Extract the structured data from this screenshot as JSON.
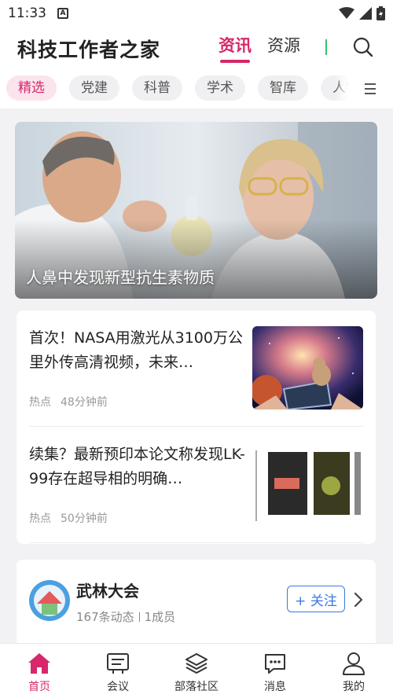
{
  "status_bar": {
    "time": "11:33",
    "a_glyph": "A"
  },
  "header": {
    "brand": "科技工作者之家",
    "tabs": [
      {
        "label": "资讯",
        "active": true
      },
      {
        "label": "资源",
        "active": false
      }
    ],
    "search_icon": "search-icon"
  },
  "categories": {
    "items": [
      {
        "label": "精选",
        "active": true
      },
      {
        "label": "党建",
        "active": false
      },
      {
        "label": "科普",
        "active": false
      },
      {
        "label": "学术",
        "active": false
      },
      {
        "label": "智库",
        "active": false
      },
      {
        "label": "人物",
        "active": false
      }
    ],
    "more_icon": "menu-icon"
  },
  "hero": {
    "title": "人鼻中发现新型抗生素物质"
  },
  "news": [
    {
      "title": "首次！NASA用激光从3100万公里外传高清视频，未来…",
      "tag": "热点",
      "time": "48分钟前"
    },
    {
      "title": "续集？最新预印本论文称发现LK-99存在超导相的明确…",
      "tag": "热点",
      "time": "50分钟前"
    }
  ],
  "community": {
    "name": "武林大会",
    "posts": "167条动态",
    "members": "1成员",
    "follow_label": "+ 关注"
  },
  "bottom_nav": [
    {
      "label": "首页",
      "icon": "home-icon",
      "active": true
    },
    {
      "label": "会议",
      "icon": "meeting-icon",
      "active": false
    },
    {
      "label": "部落社区",
      "icon": "layers-icon",
      "active": false
    },
    {
      "label": "消息",
      "icon": "chat-icon",
      "active": false
    },
    {
      "label": "我的",
      "icon": "user-icon",
      "active": false
    }
  ],
  "colors": {
    "accent": "#d6286a",
    "follow_blue": "#3a7be0",
    "divider_green": "#3cc06a"
  }
}
